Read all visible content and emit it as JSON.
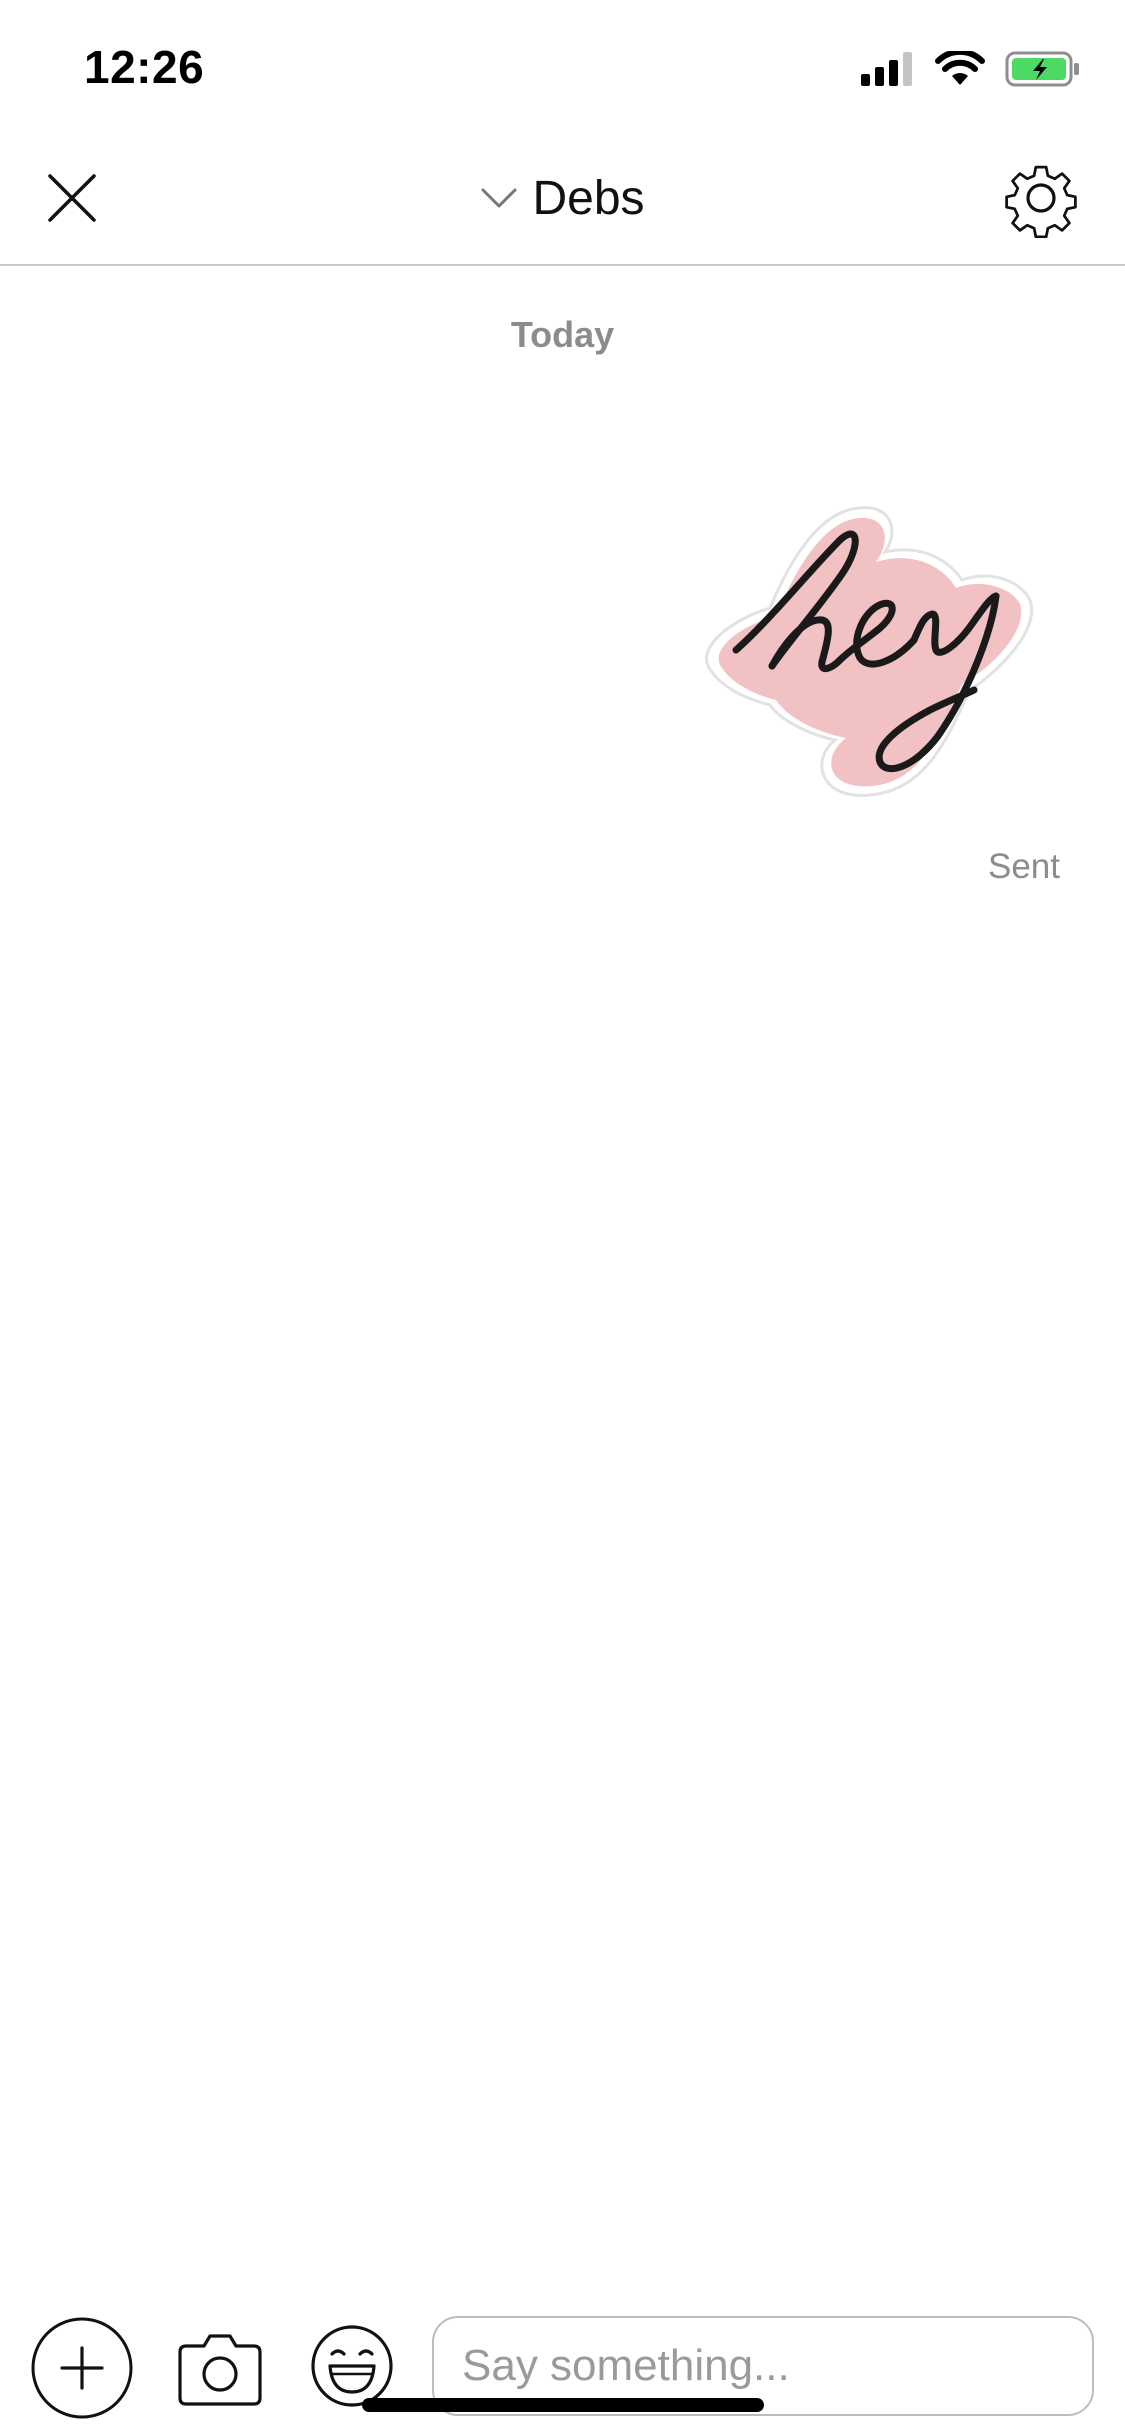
{
  "status_bar": {
    "time": "12:26",
    "icons": [
      "cellular-signal-icon",
      "wifi-icon",
      "battery-charging-icon"
    ],
    "battery_color": "#4cd964"
  },
  "header": {
    "title": "Debs",
    "icons": {
      "close": "close-icon",
      "dropdown": "chevron-down-icon",
      "settings": "gear-icon"
    }
  },
  "conversation": {
    "date_divider": "Today",
    "messages": [
      {
        "type": "sticker",
        "sticker_text": "hey",
        "sticker_color": "#f2c1c3",
        "status": "Sent"
      }
    ]
  },
  "composer": {
    "placeholder": "Say something...",
    "value": "",
    "icons": {
      "add": "plus-circle-icon",
      "camera": "camera-icon",
      "emoji": "smiley-icon"
    }
  }
}
